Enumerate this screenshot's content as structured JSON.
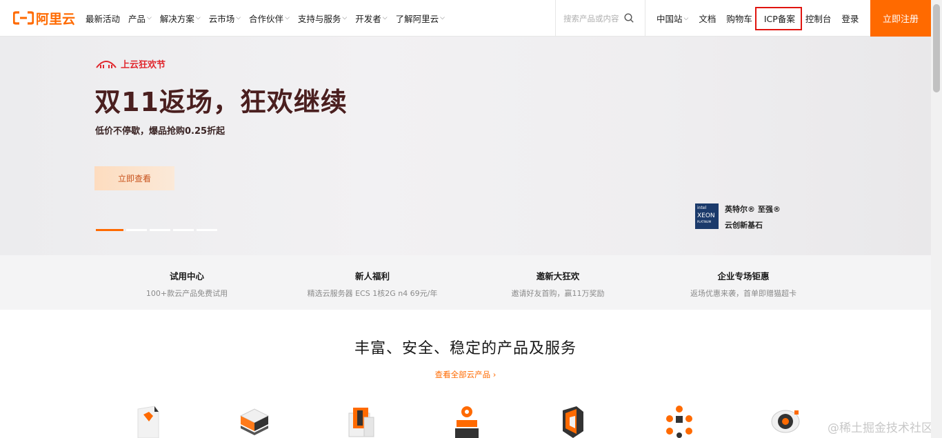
{
  "logo": {
    "text": "阿里云"
  },
  "nav": {
    "items": [
      {
        "label": "最新活动",
        "has_dropdown": false
      },
      {
        "label": "产品",
        "has_dropdown": true
      },
      {
        "label": "解决方案",
        "has_dropdown": true
      },
      {
        "label": "云市场",
        "has_dropdown": true
      },
      {
        "label": "合作伙伴",
        "has_dropdown": true
      },
      {
        "label": "支持与服务",
        "has_dropdown": true
      },
      {
        "label": "开发者",
        "has_dropdown": true
      },
      {
        "label": "了解阿里云",
        "has_dropdown": true
      }
    ],
    "chevron": "⌵",
    "search_placeholder": "搜索产品或内容",
    "right_links": {
      "region": "中国站",
      "docs": "文档",
      "cart": "购物车",
      "icp": "ICP备案",
      "console": "控制台",
      "login": "登录"
    },
    "register": "立即注册"
  },
  "hero": {
    "tag": "上云狂欢节",
    "title": "双11返场，狂欢继续",
    "subtitle": "低价不停歇，爆品抢购0.25折起",
    "button": "立即查看",
    "slides_total": 5,
    "slide_active": 1,
    "partner": {
      "logo_brand": "intel",
      "logo_product": "XEON",
      "logo_tier": "PLATINUM",
      "line1": "英特尔® 至强®",
      "line2": "云创新基石"
    }
  },
  "features": [
    {
      "title": "试用中心",
      "desc": "100+款云产品免费试用"
    },
    {
      "title": "新人福利",
      "desc": "精选云服务器 ECS 1核2G n4 69元/年"
    },
    {
      "title": "邀新大狂欢",
      "desc": "邀请好友首购，赢11万奖励"
    },
    {
      "title": "企业专场钜惠",
      "desc": "返场优惠来袭，首单即赠猫超卡"
    }
  ],
  "section": {
    "title": "丰富、安全、稳定的产品及服务",
    "link": "查看全部云产品 ›"
  },
  "product_icons": [
    "elastic-compute-icon",
    "storage-icon",
    "database-icon",
    "ai-icon",
    "security-icon",
    "network-icon",
    "cloud-service-icon"
  ],
  "watermark": "@稀土掘金技术社区",
  "colors": {
    "brand": "#ff6a00",
    "hero_title": "#4a1f1f",
    "highlight_border": "#e0140f"
  }
}
